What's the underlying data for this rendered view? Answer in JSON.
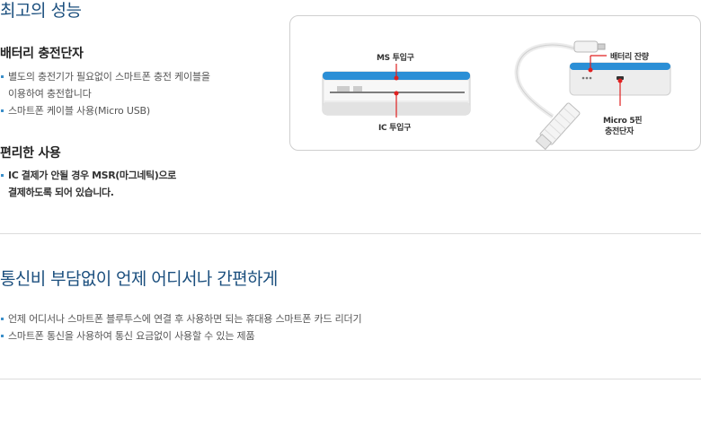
{
  "performance": {
    "title": "최고의 성능",
    "battery": {
      "subtitle": "배터리 충전단자",
      "bullets": [
        "별도의 충전기가 필요없이 스마트폰 충전 케이블을",
        "이용하여 충전합니다",
        "스마트폰 케이블 사용(Micro USB)"
      ]
    },
    "convenience": {
      "subtitle": "편리한 사용",
      "bullets": [
        "IC 결제가 안될 경우 MSR(마그네틱)으로",
        "결제하도록 되어 있습니다."
      ]
    },
    "figure": {
      "labels": {
        "ms_slot": "MS 투입구",
        "ic_slot": "IC 투입구",
        "battery_level": "배터리 잔량",
        "micro_line1": "Micro 5핀",
        "micro_line2": "충전단자"
      },
      "colors": {
        "device_blue": "#2b8fd6",
        "device_body": "#f2f2f2",
        "marker_red": "#e02020"
      }
    }
  },
  "communication": {
    "title": "통신비 부담없이 언제 어디서나 간편하게",
    "bullets": [
      "언제 어디서나 스마트폰 블루투스에 연결 후 사용하면 되는 휴대용 스마트폰 카드 리더기",
      "스마트폰 통신을 사용하여 통신 요금없이 사용할 수 있는 제품"
    ]
  }
}
